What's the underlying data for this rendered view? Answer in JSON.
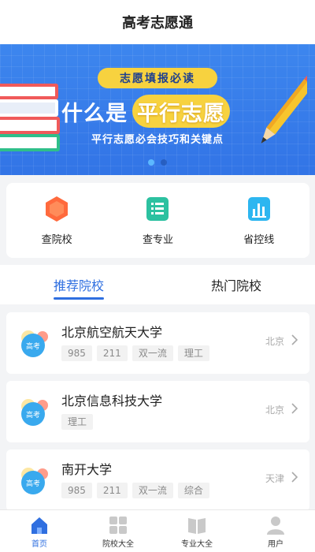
{
  "header": {
    "title": "高考志愿通"
  },
  "banner": {
    "pill": "志愿填报必读",
    "main_white": "什么是",
    "main_yellow": "平行志愿",
    "subtitle": "平行志愿必会技巧和关键点",
    "active_dot": 1,
    "dot_count": 2
  },
  "quick_actions": [
    {
      "label": "查院校",
      "icon": "hexagon-school-icon"
    },
    {
      "label": "查专业",
      "icon": "list-document-icon"
    },
    {
      "label": "省控线",
      "icon": "bar-chart-icon"
    }
  ],
  "tabs": [
    {
      "label": "推荐院校",
      "active": true
    },
    {
      "label": "热门院校",
      "active": false
    }
  ],
  "schools": [
    {
      "name": "北京航空航天大学",
      "tags": [
        "985",
        "211",
        "双一流",
        "理工"
      ],
      "location": "北京",
      "logo_text": "高考"
    },
    {
      "name": "北京信息科技大学",
      "tags": [
        "理工"
      ],
      "location": "北京",
      "logo_text": "高考"
    },
    {
      "name": "南开大学",
      "tags": [
        "985",
        "211",
        "双一流",
        "综合"
      ],
      "location": "天津",
      "logo_text": "高考"
    }
  ],
  "bottom_nav": [
    {
      "label": "首页",
      "icon": "home-icon",
      "active": true
    },
    {
      "label": "院校大全",
      "icon": "grid-icon",
      "active": false
    },
    {
      "label": "专业大全",
      "icon": "book-icon",
      "active": false
    },
    {
      "label": "用户",
      "icon": "user-icon",
      "active": false
    }
  ],
  "colors": {
    "accent": "#2f6fe0",
    "banner": "#3d86ee",
    "highlight": "#f7d23f"
  }
}
